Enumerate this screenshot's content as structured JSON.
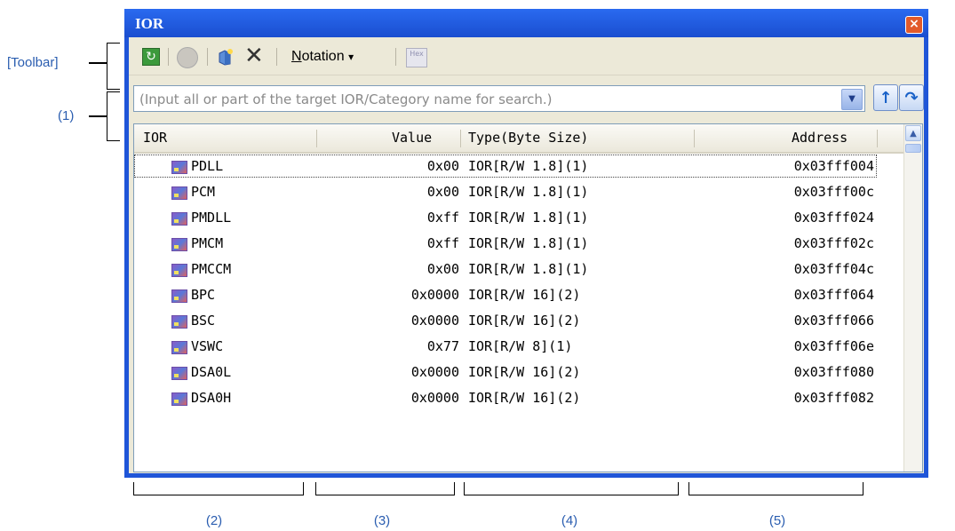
{
  "callouts": {
    "toolbar": "[Toolbar]",
    "search": "(1)",
    "col_ior": "(2)",
    "col_value": "(3)",
    "col_type": "(4)",
    "col_address": "(5)"
  },
  "window": {
    "title": "IOR",
    "close_glyph": "×"
  },
  "toolbar": {
    "refresh_glyph": "↻",
    "delete_glyph": "✕",
    "notation_label": "otation",
    "notation_mnemonic": "N",
    "notation_arrow": "▾",
    "hex_label": "Hex"
  },
  "search": {
    "placeholder": "(Input all or part of the target IOR/Category name for search.)",
    "dropdown_glyph": "▼",
    "prev_glyph": "↑",
    "next_glyph": "↷"
  },
  "grid": {
    "headers": {
      "ior": "IOR",
      "value": "Value",
      "type": "Type(Byte Size)",
      "address": "Address"
    },
    "rows": [
      {
        "name": "PDLL",
        "value": "0x00",
        "type": "IOR[R/W 1.8](1)",
        "address": "0x03fff004"
      },
      {
        "name": "PCM",
        "value": "0x00",
        "type": "IOR[R/W 1.8](1)",
        "address": "0x03fff00c"
      },
      {
        "name": "PMDLL",
        "value": "0xff",
        "type": "IOR[R/W 1.8](1)",
        "address": "0x03fff024"
      },
      {
        "name": "PMCM",
        "value": "0xff",
        "type": "IOR[R/W 1.8](1)",
        "address": "0x03fff02c"
      },
      {
        "name": "PMCCM",
        "value": "0x00",
        "type": "IOR[R/W 1.8](1)",
        "address": "0x03fff04c"
      },
      {
        "name": "BPC",
        "value": "0x0000",
        "type": "IOR[R/W 16](2)",
        "address": "0x03fff064"
      },
      {
        "name": "BSC",
        "value": "0x0000",
        "type": "IOR[R/W 16](2)",
        "address": "0x03fff066"
      },
      {
        "name": "VSWC",
        "value": "0x77",
        "type": "IOR[R/W 8](1)",
        "address": "0x03fff06e"
      },
      {
        "name": "DSA0L",
        "value": "0x0000",
        "type": "IOR[R/W 16](2)",
        "address": "0x03fff080"
      },
      {
        "name": "DSA0H",
        "value": "0x0000",
        "type": "IOR[R/W 16](2)",
        "address": "0x03fff082"
      }
    ],
    "scroll_up_glyph": "▲"
  }
}
